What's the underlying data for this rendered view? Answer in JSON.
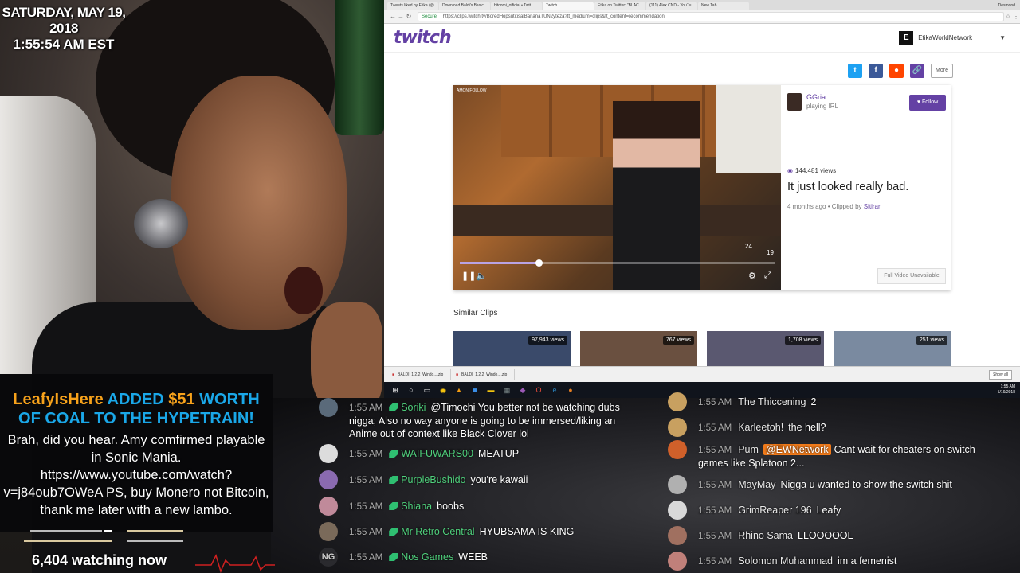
{
  "overlay": {
    "date": "SATURDAY, MAY 19, 2018",
    "time": "1:55:54 AM EST",
    "alert_user": "LeafyIsHere",
    "alert_added": "ADDED",
    "alert_amount": "$51",
    "alert_worth": "WORTH",
    "alert_line2": "OF COAL TO THE HYPETRAIN!",
    "alert_message": "Brah, did you hear. Amy comfirmed playable in Sonic Mania. https://www.youtube.com/watch?v=j84oub7OWeA PS, buy Monero not Bitcoin, thank me later with a new lambo.",
    "watching": "6,404 watching now"
  },
  "browser": {
    "tabs": [
      "Tweets liked by Etika (@...",
      "Download Baldi's Basic...",
      "bitcomi_official • Twit...",
      "Twitch",
      "Etika on Twitter: \"BLAC...",
      "(111) Alex CND - YouTu...",
      "New Tab"
    ],
    "active_tab": 3,
    "window_user": "Desmond",
    "secure_label": "Secure",
    "url": "https://clips.twitch.tv/BoredHopsutitisalBananaTUN2yteza?tt_medium=clips&tt_content=recommendation",
    "logo": "twitch",
    "account_name": "EtikaWorldNetwork",
    "account_icon": "E",
    "share_more": "More",
    "streamer_name": "GGria",
    "streamer_activity": "playing IRL",
    "follow_label": "Follow",
    "views": "144,481 views",
    "clip_title": "It just looked really bad.",
    "clip_age": "4 months ago",
    "clipped_by_label": "Clipped by",
    "clipped_by": "Sitiran",
    "full_video": "Full Video Unavailable",
    "video_progress": 0.25,
    "video_num_a": "24",
    "video_num_b": "19",
    "video_sign": "AMON FOLLOW",
    "similar_label": "Similar Clips",
    "similar": [
      {
        "views": "97,943 views",
        "color": "#3a4a6a"
      },
      {
        "views": "767 views",
        "color": "#6a5040"
      },
      {
        "views": "1,708 views",
        "color": "#5a5870"
      },
      {
        "views": "251 views",
        "color": "#7a8aa0"
      }
    ],
    "downloads": [
      "BALDI_1.2.2_Windo....zip",
      "BALDI_1.2.2_Windo....zip"
    ],
    "show_all": "Show all",
    "clock_time": "1:55 AM",
    "clock_date": "5/19/2018"
  },
  "chat": {
    "messages_left": [
      {
        "time": "1:55 AM",
        "user": "Soriki",
        "text": "@Timochi You better not be watching dubs nigga; Also no way anyone is going to be immersed/liking an Anime out of context like Black Clover lol",
        "avatar": "#5a6a7a"
      },
      {
        "time": "1:55 AM",
        "user": "WAIFUWARS00",
        "text": "MEATUP",
        "avatar": "#dcdcdc"
      },
      {
        "time": "1:55 AM",
        "user": "PurpleBushido",
        "text": "you're kawaii",
        "avatar": "#8a6ab0"
      },
      {
        "time": "1:55 AM",
        "user": "Shiana",
        "text": "boobs",
        "avatar": "#c08a9a"
      },
      {
        "time": "1:55 AM",
        "user": "Mr Retro Central",
        "text": "HYUBSAMA IS KING",
        "avatar": "#7a6a5a"
      },
      {
        "time": "1:55 AM",
        "user": "Nos Games",
        "text": "WEEB",
        "avatar": "#2a2a2e",
        "avatar_text": "NG"
      }
    ],
    "messages_right": [
      {
        "time": "1:55 AM",
        "user": "The Thiccening",
        "text": "2",
        "avatar": "#c8a060"
      },
      {
        "time": "1:55 AM",
        "user": "Karleetoh!",
        "text": "the hell?",
        "avatar": "#c8a060"
      },
      {
        "time": "1:55 AM",
        "user": "Pum",
        "mention": "@EWNetwork",
        "text": "Cant wait for cheaters on switch games like Splatoon 2...",
        "avatar": "#d0602a"
      },
      {
        "time": "1:55 AM",
        "user": "MayMay",
        "text": "Nigga u wanted to show the switch shit",
        "avatar": "#b0b0b0"
      },
      {
        "time": "1:55 AM",
        "user": "GrimReaper 196",
        "text": "Leafy",
        "avatar": "#d8d8d8"
      },
      {
        "time": "1:55 AM",
        "user": "Rhino Sama",
        "text": "LLOOOOOL",
        "avatar": "#a07060"
      },
      {
        "time": "1:55 AM",
        "user": "Solomon Muhammad",
        "text": "im a femenist",
        "avatar": "#c0807a"
      }
    ]
  },
  "colors": {
    "twitch": "#6441a4",
    "chat_user": "#4fd07c",
    "alert_blue": "#1aa7e8",
    "alert_orange": "#f7a21b"
  }
}
